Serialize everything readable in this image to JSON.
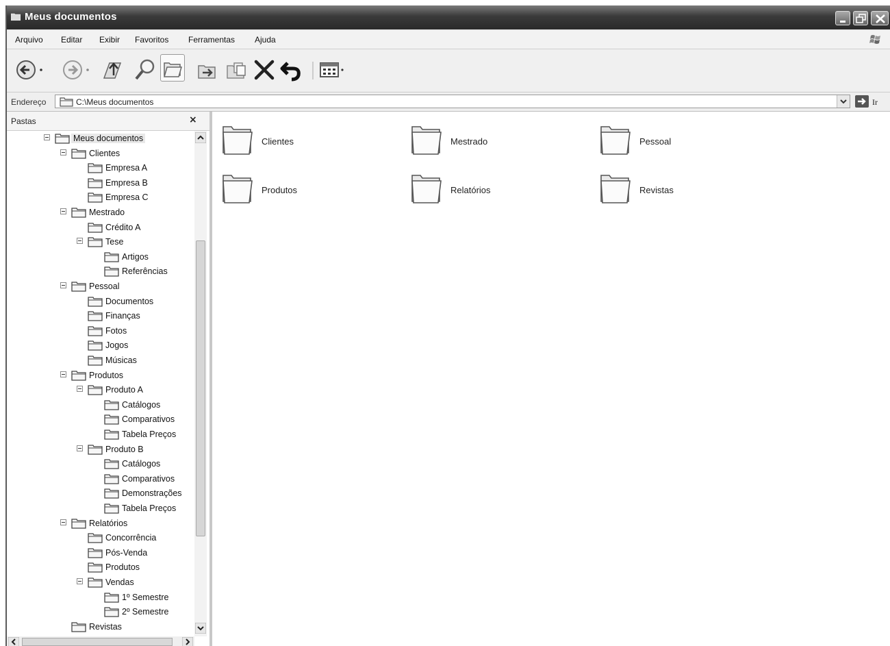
{
  "window": {
    "title": "Meus documentos"
  },
  "menu": [
    "Arquivo",
    "Editar",
    "Exibir",
    "Favoritos",
    "Ferramentas",
    "Ajuda"
  ],
  "toolbar": {
    "icons": [
      "back-icon",
      "forward-icon",
      "up-folder-icon",
      "search-icon",
      "folders-icon",
      "move-to-icon",
      "copy-to-icon",
      "delete-icon",
      "undo-icon",
      "views-icon"
    ]
  },
  "address": {
    "label": "Endereço",
    "value": "C:\\Meus documentos",
    "go_label": "Ir"
  },
  "pane": {
    "title": "Pastas",
    "close_glyph": "×"
  },
  "tree": [
    {
      "label": "Meus documentos",
      "level": 0,
      "expanded": true
    },
    {
      "label": "Clientes",
      "level": 1,
      "expanded": true
    },
    {
      "label": "Empresa A",
      "level": 2
    },
    {
      "label": "Empresa B",
      "level": 2
    },
    {
      "label": "Empresa C",
      "level": 2
    },
    {
      "label": "Mestrado",
      "level": 1,
      "expanded": true
    },
    {
      "label": "Crédito A",
      "level": 2
    },
    {
      "label": "Tese",
      "level": 2,
      "expanded": true
    },
    {
      "label": "Artigos",
      "level": 3
    },
    {
      "label": "Referências",
      "level": 3
    },
    {
      "label": "Pessoal",
      "level": 1,
      "expanded": true
    },
    {
      "label": "Documentos",
      "level": 2
    },
    {
      "label": "Finanças",
      "level": 2
    },
    {
      "label": "Fotos",
      "level": 2
    },
    {
      "label": "Jogos",
      "level": 2
    },
    {
      "label": "Músicas",
      "level": 2
    },
    {
      "label": "Produtos",
      "level": 1,
      "expanded": true
    },
    {
      "label": "Produto A",
      "level": 2,
      "expanded": true
    },
    {
      "label": "Catálogos",
      "level": 3
    },
    {
      "label": "Comparativos",
      "level": 3
    },
    {
      "label": "Tabela Preços",
      "level": 3
    },
    {
      "label": "Produto B",
      "level": 2,
      "expanded": true
    },
    {
      "label": "Catálogos",
      "level": 3
    },
    {
      "label": "Comparativos",
      "level": 3
    },
    {
      "label": "Demonstrações",
      "level": 3
    },
    {
      "label": "Tabela Preços",
      "level": 3
    },
    {
      "label": "Relatórios",
      "level": 1,
      "expanded": true
    },
    {
      "label": "Concorrência",
      "level": 2
    },
    {
      "label": "Pós-Venda",
      "level": 2
    },
    {
      "label": "Produtos",
      "level": 2
    },
    {
      "label": "Vendas",
      "level": 2,
      "expanded": true
    },
    {
      "label": "1º Semestre",
      "level": 3
    },
    {
      "label": "2º Semestre",
      "level": 3
    },
    {
      "label": "Revistas",
      "level": 1
    }
  ],
  "content": {
    "items": [
      "Clientes",
      "Mestrado",
      "Pessoal",
      "Produtos",
      "Relatórios",
      "Revistas"
    ]
  }
}
